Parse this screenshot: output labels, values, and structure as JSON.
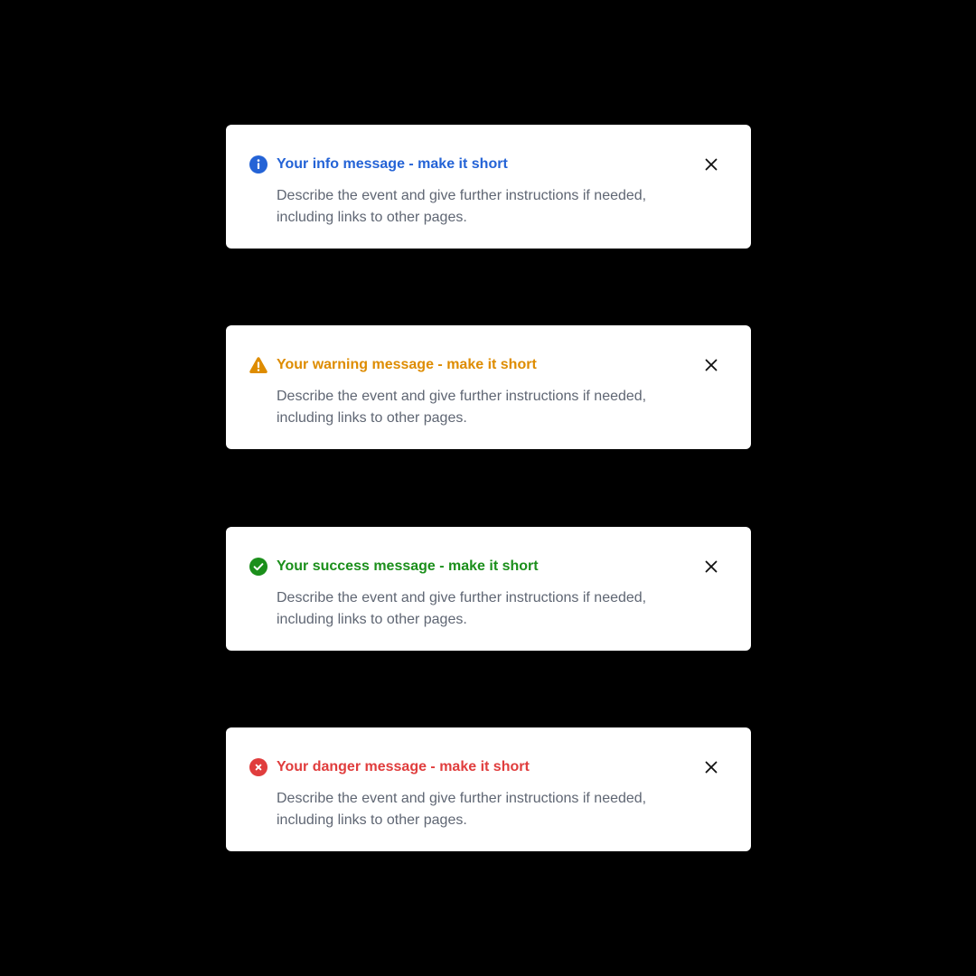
{
  "colors": {
    "background": "#000000",
    "card": "#ffffff",
    "body_text": "#5f6673",
    "close_icon": "#111111"
  },
  "alerts": [
    {
      "type": "info",
      "icon": "info-icon",
      "color": "#2463d6",
      "title": "Your info message - make it short",
      "body_line1": "Describe the event and give further instructions if needed,",
      "body_line2": "including links to other pages.",
      "close_icon": "close-icon"
    },
    {
      "type": "warning",
      "icon": "warning-icon",
      "color": "#de8c00",
      "title": "Your warning message - make it short",
      "body_line1": "Describe the event and give further instructions if needed,",
      "body_line2": "including links to other pages.",
      "close_icon": "close-icon"
    },
    {
      "type": "success",
      "icon": "check-circle-icon",
      "color": "#1b8f1b",
      "title": "Your success message - make it short",
      "body_line1": "Describe the event and give further instructions if needed,",
      "body_line2": "including links to other pages.",
      "close_icon": "close-icon"
    },
    {
      "type": "danger",
      "icon": "error-circle-icon",
      "color": "#e03d3d",
      "title": "Your danger message - make it short",
      "body_line1": "Describe the event and give further instructions if needed,",
      "body_line2": "including links to other pages.",
      "close_icon": "close-icon"
    }
  ]
}
